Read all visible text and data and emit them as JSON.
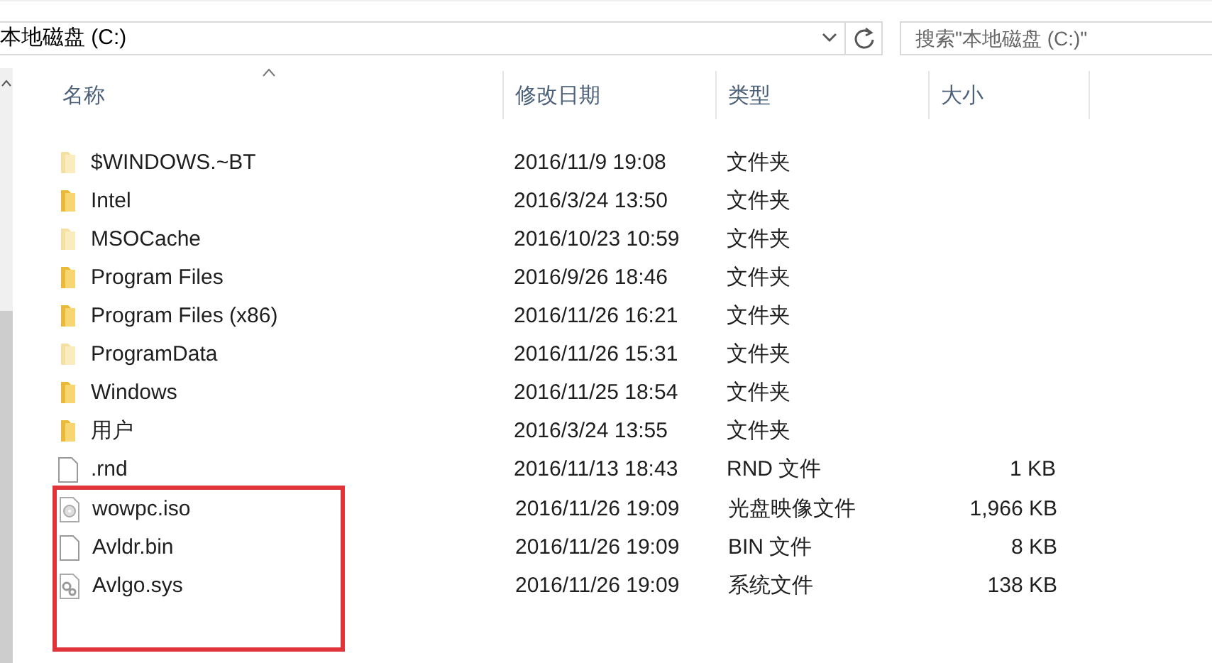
{
  "address_bar": {
    "path": "本地磁盘 (C:)"
  },
  "search": {
    "placeholder": "搜索\"本地磁盘 (C:)\""
  },
  "table": {
    "columns": [
      {
        "label": "名称",
        "sorted": true
      },
      {
        "label": "修改日期",
        "sorted": false
      },
      {
        "label": "类型",
        "sorted": false
      },
      {
        "label": "大小",
        "sorted": false
      }
    ],
    "rows": [
      {
        "kind": "folder",
        "hidden": true,
        "highlighted": false,
        "name": "$WINDOWS.~BT",
        "date": "2016/11/9 19:08",
        "type": "文件夹",
        "size": ""
      },
      {
        "kind": "folder",
        "hidden": false,
        "highlighted": false,
        "name": "Intel",
        "date": "2016/3/24 13:50",
        "type": "文件夹",
        "size": ""
      },
      {
        "kind": "folder",
        "hidden": true,
        "highlighted": false,
        "name": "MSOCache",
        "date": "2016/10/23 10:59",
        "type": "文件夹",
        "size": ""
      },
      {
        "kind": "folder",
        "hidden": false,
        "highlighted": false,
        "name": "Program Files",
        "date": "2016/9/26 18:46",
        "type": "文件夹",
        "size": ""
      },
      {
        "kind": "folder",
        "hidden": false,
        "highlighted": false,
        "name": "Program Files (x86)",
        "date": "2016/11/26 16:21",
        "type": "文件夹",
        "size": ""
      },
      {
        "kind": "folder",
        "hidden": true,
        "highlighted": false,
        "name": "ProgramData",
        "date": "2016/11/26 15:31",
        "type": "文件夹",
        "size": ""
      },
      {
        "kind": "folder",
        "hidden": false,
        "highlighted": false,
        "name": "Windows",
        "date": "2016/11/25 18:54",
        "type": "文件夹",
        "size": ""
      },
      {
        "kind": "folder",
        "hidden": false,
        "highlighted": false,
        "name": "用户",
        "date": "2016/3/24 13:55",
        "type": "文件夹",
        "size": ""
      },
      {
        "kind": "file",
        "hidden": false,
        "highlighted": false,
        "name": ".rnd",
        "date": "2016/11/13 18:43",
        "type": "RND 文件",
        "size": "1 KB"
      },
      {
        "kind": "disc",
        "hidden": false,
        "highlighted": true,
        "name": "wowpc.iso",
        "date": "2016/11/26 19:09",
        "type": "光盘映像文件",
        "size": "1,966 KB"
      },
      {
        "kind": "file",
        "hidden": false,
        "highlighted": true,
        "name": "Avldr.bin",
        "date": "2016/11/26 19:09",
        "type": "BIN 文件",
        "size": "8 KB"
      },
      {
        "kind": "system",
        "hidden": false,
        "highlighted": true,
        "name": "Avlgo.sys",
        "date": "2016/11/26 19:09",
        "type": "系统文件",
        "size": "138 KB"
      }
    ]
  }
}
